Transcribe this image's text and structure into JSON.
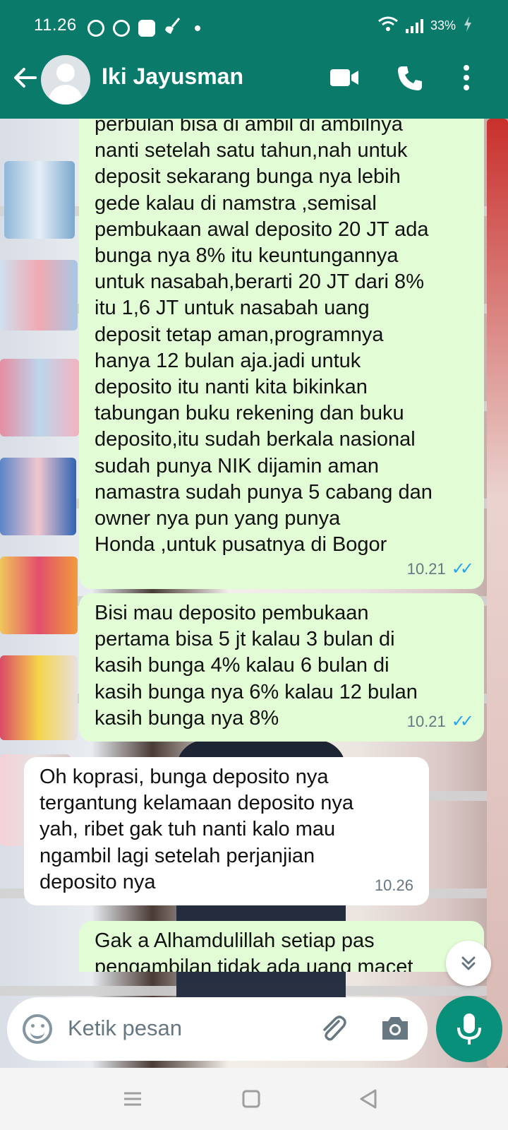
{
  "status_bar": {
    "time": "11.26",
    "battery": "33%"
  },
  "header": {
    "contact_name": "Iki Jayusman"
  },
  "messages": [
    {
      "direction": "outgoing",
      "text": "perbulan bisa di ambil di ambilnya\nnanti setelah satu tahun,nah untuk\ndeposit sekarang bunga nya lebih\ngede kalau di namstra ,semisal\npembukaan awal deposito 20 JT ada\nbunga nya 8% itu keuntungannya\nuntuk nasabah,berarti 20 JT dari 8%\nitu 1,6 JT untuk nasabah uang\ndeposit tetap aman,programnya\nhanya 12 bulan aja.jadi untuk\ndeposito itu nanti kita bikinkan\ntabungan buku rekening dan buku\ndeposito,itu sudah berkala nasional\nsudah punya NIK dijamin aman\nnamastra sudah punya 5 cabang dan\nowner nya pun yang punya\nHonda ,untuk pusatnya di Bogor",
      "time": "10.21",
      "status": "read"
    },
    {
      "direction": "outgoing",
      "text": "Bisi mau deposito pembukaan\npertama bisa 5 jt kalau 3 bulan di\nkasih bunga 4% kalau 6 bulan di\nkasih bunga nya 6% kalau 12 bulan\nkasih bunga nya 8%",
      "time": "10.21",
      "status": "read"
    },
    {
      "direction": "incoming",
      "text": "Oh koprasi, bunga deposito nya\ntergantung kelamaan deposito nya\nyah, ribet gak tuh nanti kalo mau\nngambil lagi setelah perjanjian\ndeposito nya",
      "time": "10.26"
    },
    {
      "direction": "outgoing",
      "text": "Gak a Alhamdulillah setiap pas\npengambilan tidak ada uang macet"
    }
  ],
  "composer": {
    "placeholder": "Ketik pesan"
  },
  "icons": {
    "back": "arrow-left-icon",
    "video": "video-camera-icon",
    "call": "phone-icon",
    "menu": "more-vert-icon",
    "emoji": "emoji-icon",
    "attach": "paperclip-icon",
    "camera": "camera-icon",
    "mic": "mic-icon",
    "scroll": "double-chevron-down-icon"
  },
  "colors": {
    "header": "#0a7a6b",
    "outgoing_bubble": "#e2fdd6",
    "incoming_bubble": "#ffffff",
    "read_ticks": "#2aa3ee",
    "mic_button": "#08907a"
  }
}
